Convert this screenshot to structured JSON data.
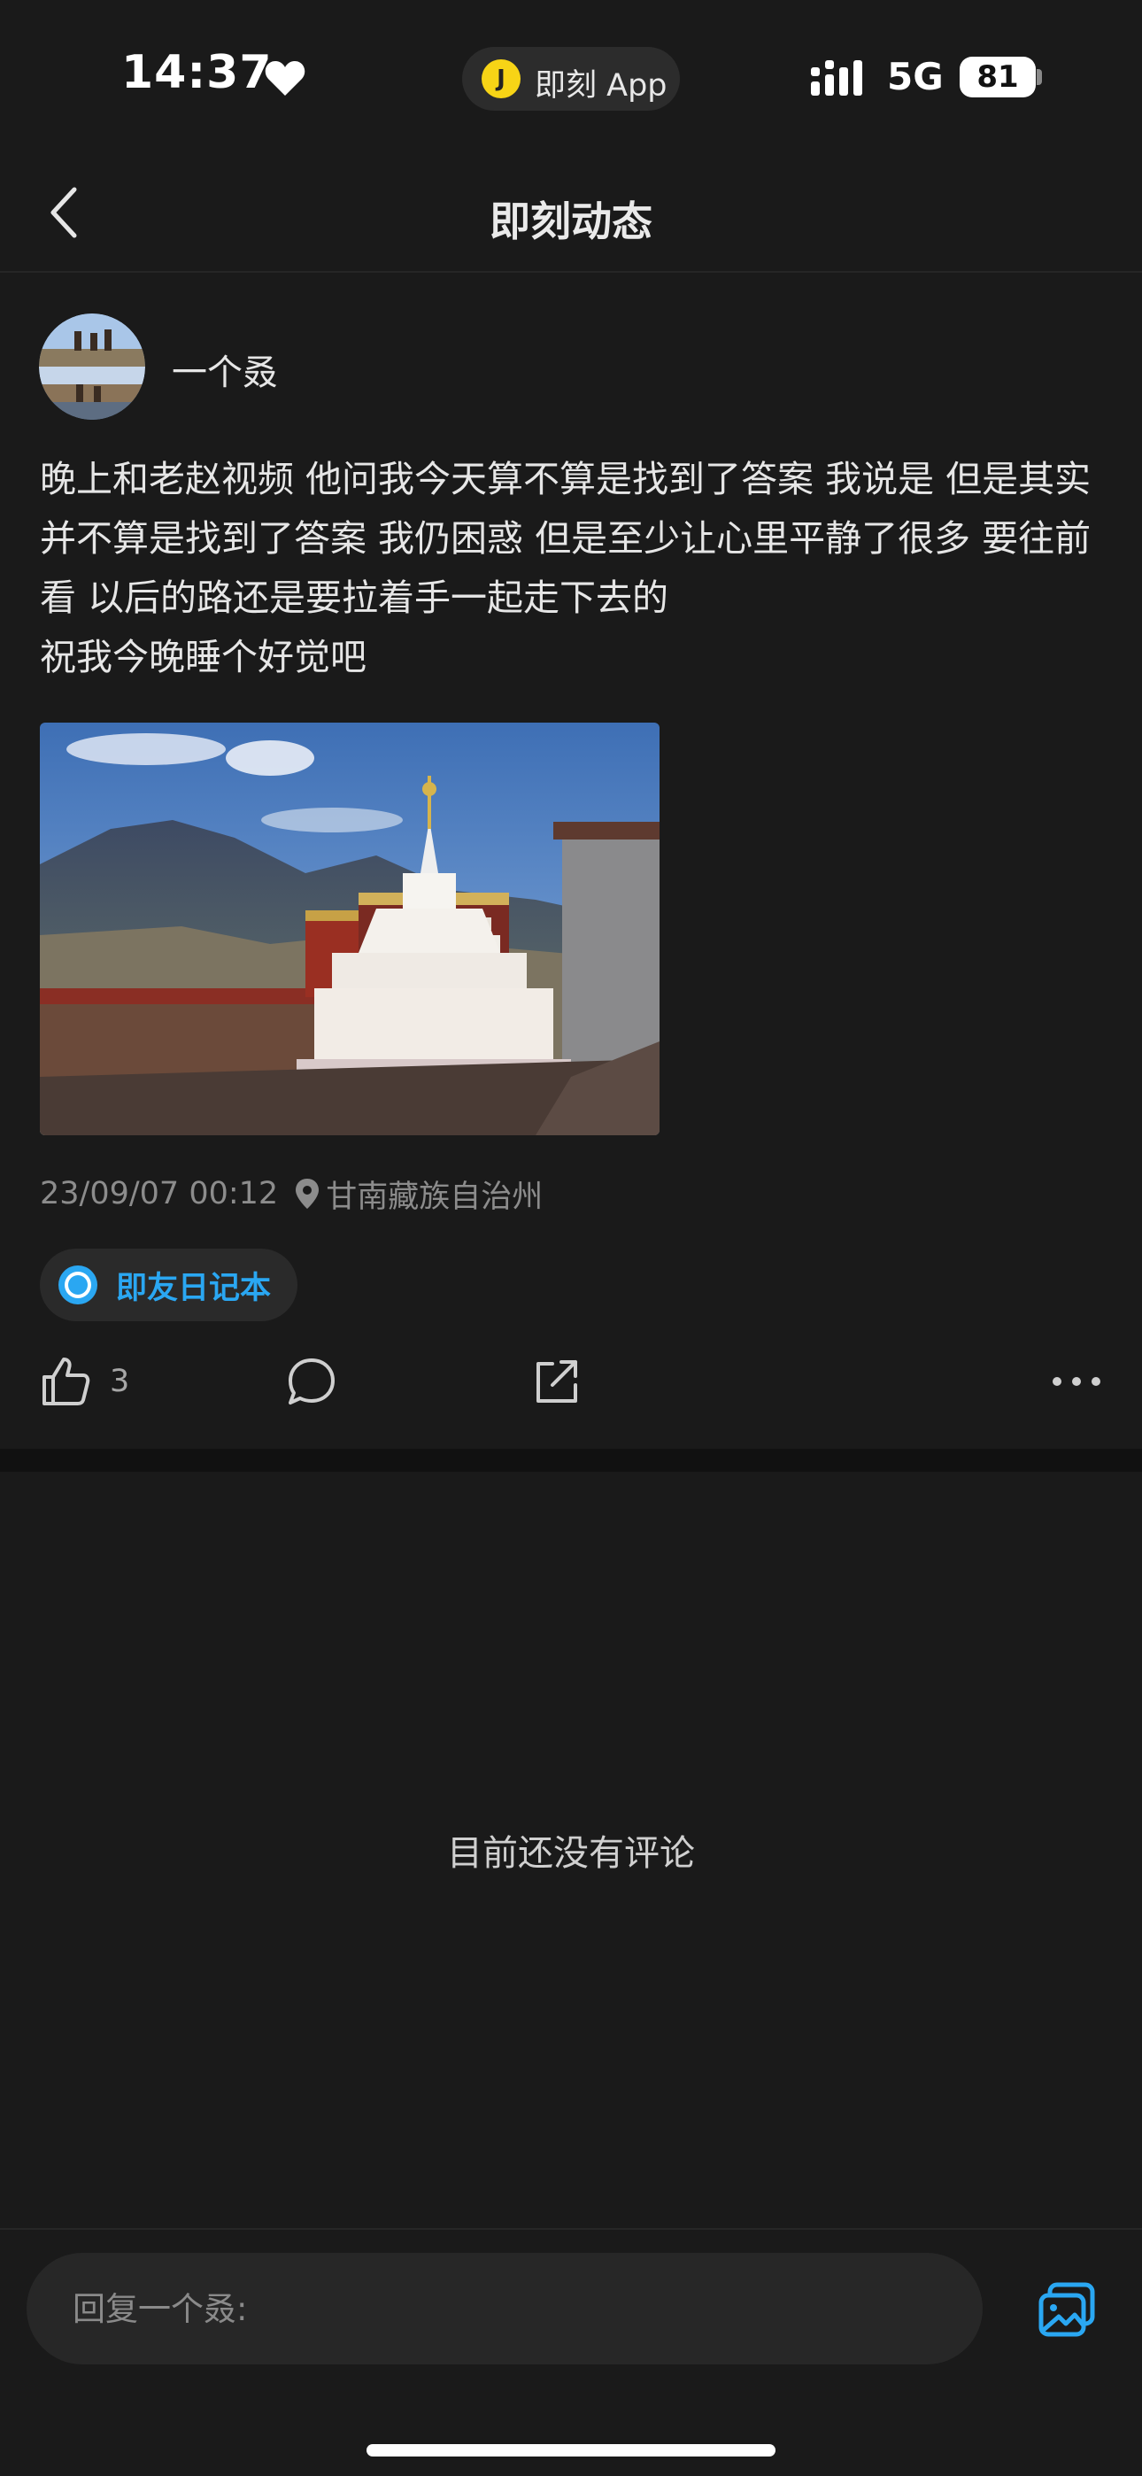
{
  "status_bar": {
    "time": "14:37",
    "island_icon_text": "J",
    "island_label": "即刻 App",
    "network": "5G",
    "battery": "81"
  },
  "nav": {
    "title": "即刻动态"
  },
  "post": {
    "author": "一个叒",
    "text": "晚上和老赵视频 他问我今天算不算是找到了答案 我说是 但是其实并不算是找到了答案 我仍困惑 但是至少让心里平静了很多 要往前看 以后的路还是要拉着手一起走下去的\n祝我今晚睡个好觉吧",
    "timestamp": "23/09/07 00:12",
    "location": "甘南藏族自治州",
    "topic": "即友日记本",
    "like_count": "3"
  },
  "comments": {
    "empty_text": "目前还没有评论"
  },
  "reply_bar": {
    "placeholder": "回复一个叒:"
  },
  "colors": {
    "background": "#1a1a1a",
    "accent": "#2aa7f2",
    "island_dot": "#f7d416"
  },
  "icons": [
    "heart-icon",
    "signal-icon",
    "back-arrow-icon",
    "location-pin-icon",
    "topic-circle-icon",
    "thumbs-up-icon",
    "comment-bubble-icon",
    "share-icon",
    "more-dots-icon",
    "image-picker-icon"
  ]
}
